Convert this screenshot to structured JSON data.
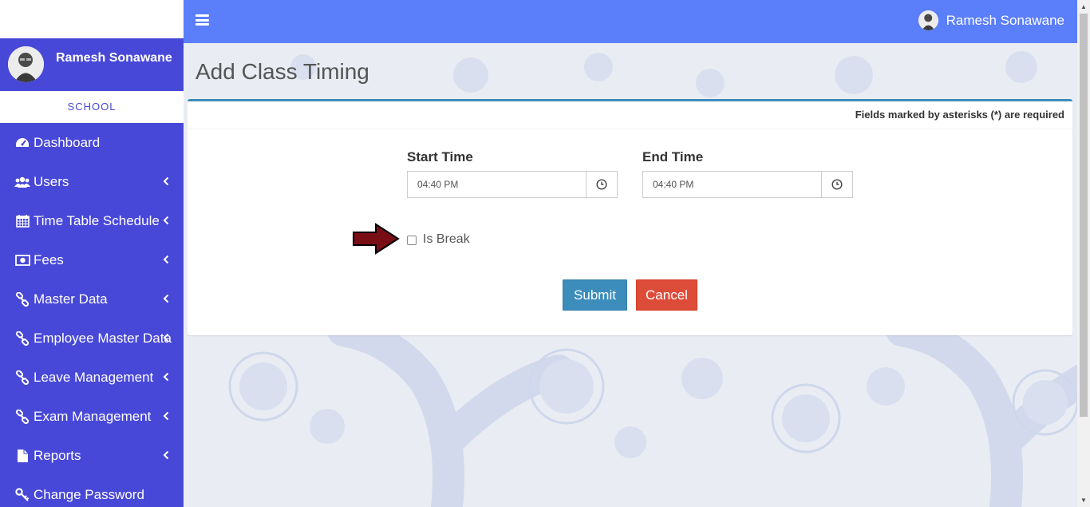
{
  "user": {
    "name": "Ramesh Sonawane"
  },
  "sidebar": {
    "school_label": "SCHOOL",
    "items": [
      {
        "label": "Dashboard",
        "icon": "dashboard-icon",
        "has_chevron": false
      },
      {
        "label": "Users",
        "icon": "users-icon",
        "has_chevron": true
      },
      {
        "label": "Time Table Schedule",
        "icon": "calendar-icon",
        "has_chevron": true
      },
      {
        "label": "Fees",
        "icon": "money-icon",
        "has_chevron": true
      },
      {
        "label": "Master Data",
        "icon": "link-icon",
        "has_chevron": true
      },
      {
        "label": "Employee Master Data",
        "icon": "link-icon",
        "has_chevron": true
      },
      {
        "label": "Leave Management",
        "icon": "link-icon",
        "has_chevron": true
      },
      {
        "label": "Exam Management",
        "icon": "link-icon",
        "has_chevron": true
      },
      {
        "label": "Reports",
        "icon": "file-icon",
        "has_chevron": true
      },
      {
        "label": "Change Password",
        "icon": "key-icon",
        "has_chevron": false
      }
    ]
  },
  "header": {
    "user_name": "Ramesh Sonawane"
  },
  "page": {
    "title": "Add Class Timing",
    "required_note": "Fields marked by asterisks (*) are required"
  },
  "form": {
    "start_time_label": "Start Time",
    "start_time_value": "04:40 PM",
    "end_time_label": "End Time",
    "end_time_value": "04:40 PM",
    "is_break_label": "Is Break",
    "is_break_checked": false,
    "submit_label": "Submit",
    "cancel_label": "Cancel"
  },
  "colors": {
    "sidebar": "#4848d8",
    "topbar": "#5b7efb",
    "primary": "#3c8dbc",
    "danger": "#dd4b39",
    "annotation_arrow": "#7a0e17"
  }
}
